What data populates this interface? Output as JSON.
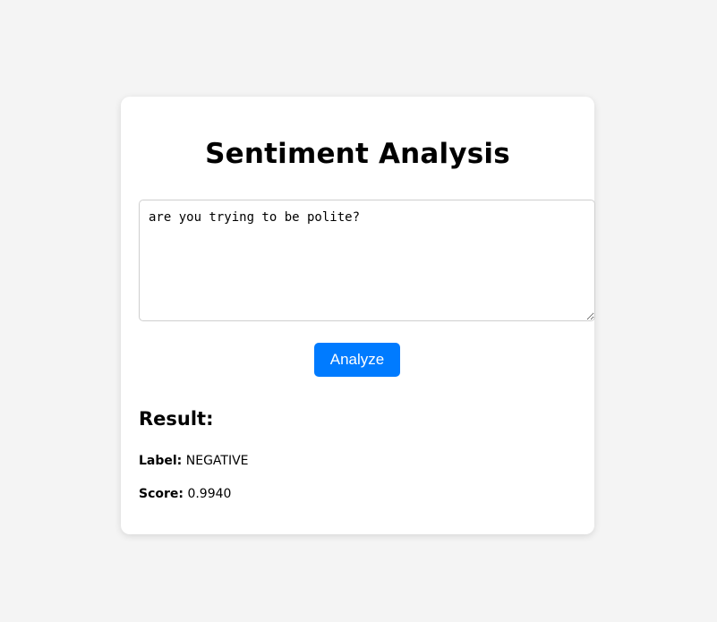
{
  "page": {
    "title": "Sentiment Analysis"
  },
  "input": {
    "value": "are you trying to be polite?"
  },
  "actions": {
    "analyze_label": "Analyze"
  },
  "result": {
    "heading": "Result:",
    "label_key": "Label:",
    "label_value": "NEGATIVE",
    "score_key": "Score:",
    "score_value": "0.9940"
  },
  "colors": {
    "page_background": "#f4f4f4",
    "card_background": "#ffffff",
    "button_background": "#007bff",
    "button_text": "#ffffff"
  }
}
